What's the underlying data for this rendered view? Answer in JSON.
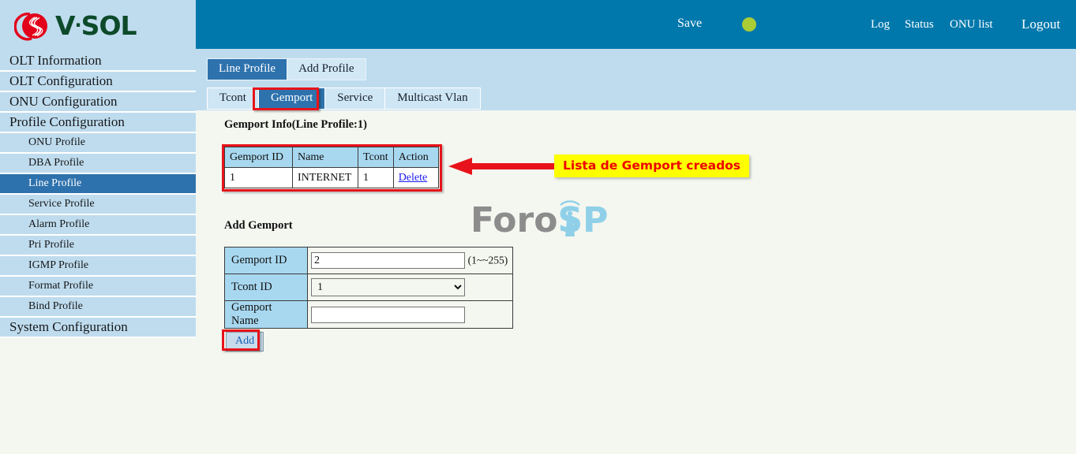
{
  "brand": {
    "name": "V·SOL",
    "logo_icon": "vsol-logo-icon",
    "name_part1": "V",
    "name_dot": "·",
    "name_part2": "SOL"
  },
  "header": {
    "save_label": "Save",
    "status_led": "status-indicator-green",
    "led_color": "#aacd35",
    "links": [
      {
        "label": "Log"
      },
      {
        "label": "Status"
      },
      {
        "label": "ONU list"
      },
      {
        "label": "Logout"
      }
    ],
    "bg_color": "#0078ac"
  },
  "sidebar": {
    "bg_color": "#bfdcee",
    "active_color": "#2e72ad",
    "items": [
      {
        "label": "OLT Information",
        "level": "top",
        "active": false
      },
      {
        "label": "OLT Configuration",
        "level": "top",
        "active": false
      },
      {
        "label": "ONU Configuration",
        "level": "top",
        "active": false
      },
      {
        "label": "Profile Configuration",
        "level": "top",
        "active": false
      },
      {
        "label": "ONU Profile",
        "level": "sub",
        "active": false
      },
      {
        "label": "DBA Profile",
        "level": "sub",
        "active": false
      },
      {
        "label": "Line Profile",
        "level": "sub",
        "active": true
      },
      {
        "label": "Service Profile",
        "level": "sub",
        "active": false
      },
      {
        "label": "Alarm Profile",
        "level": "sub",
        "active": false
      },
      {
        "label": "Pri Profile",
        "level": "sub",
        "active": false
      },
      {
        "label": "IGMP Profile",
        "level": "sub",
        "active": false
      },
      {
        "label": "Format Profile",
        "level": "sub",
        "active": false
      },
      {
        "label": "Bind Profile",
        "level": "sub",
        "active": false
      },
      {
        "label": "System Configuration",
        "level": "top",
        "active": false
      }
    ]
  },
  "tabs_outer": [
    {
      "label": "Line Profile",
      "active": true
    },
    {
      "label": "Add Profile",
      "active": false
    }
  ],
  "tabs_inner": [
    {
      "label": "Tcont",
      "active": false
    },
    {
      "label": "Gemport",
      "active": true
    },
    {
      "label": "Service",
      "active": false
    },
    {
      "label": "Multicast Vlan",
      "active": false
    }
  ],
  "gemport_info": {
    "title": "Gemport Info(Line Profile:1)",
    "columns": [
      "Gemport ID",
      "Name",
      "Tcont",
      "Action"
    ],
    "rows": [
      {
        "gemport_id": "1",
        "name": "INTERNET",
        "tcont": "1",
        "action": "Delete"
      }
    ]
  },
  "add_gemport": {
    "title": "Add Gemport",
    "fields": [
      {
        "label": "Gemport ID",
        "value": "2",
        "hint": "(1~~255)"
      },
      {
        "label": "Tcont ID",
        "value": "1",
        "options": [
          "1"
        ]
      },
      {
        "label": "Gemport Name",
        "value": "",
        "placeholder": ""
      }
    ],
    "submit_label": "Add"
  },
  "annotation": {
    "callout_text": "Lista de Gemport creados",
    "box_color": "#ffff00",
    "text_color": "#ee0000",
    "highlight_color": "#e8131a"
  },
  "watermark": {
    "part1": "Foro",
    "part2": "SP",
    "icon": "antenna-tower-icon"
  }
}
